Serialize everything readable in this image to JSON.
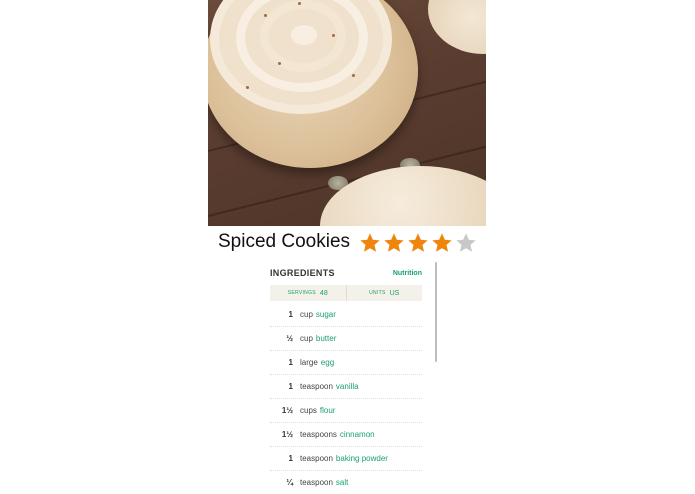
{
  "recipe": {
    "title": "Spiced Cookies",
    "rating": 4,
    "rating_max": 5,
    "star_color": "#f0850b",
    "star_empty_color": "#c8c8c8"
  },
  "ingredients": {
    "title": "INGREDIENTS",
    "nutrition_label": "Nutrition",
    "servings_label": "servings",
    "servings_value": "48",
    "units_label": "units",
    "units_value": "US",
    "accent_color": "#1a9e74",
    "items": [
      {
        "qty": "1",
        "unit": "cup",
        "name": "sugar"
      },
      {
        "qty": "½",
        "unit": "cup",
        "name": "butter"
      },
      {
        "qty": "1",
        "unit": "large",
        "name": "egg"
      },
      {
        "qty": "1",
        "unit": "teaspoon",
        "name": "vanilla"
      },
      {
        "qty": "1½",
        "unit": "cups",
        "name": "flour"
      },
      {
        "qty": "1½",
        "unit": "teaspoons",
        "name": "cinnamon"
      },
      {
        "qty": "1",
        "unit": "teaspoon",
        "name": "baking powder"
      },
      {
        "qty": "¼",
        "unit": "teaspoon",
        "name": "salt"
      }
    ]
  }
}
